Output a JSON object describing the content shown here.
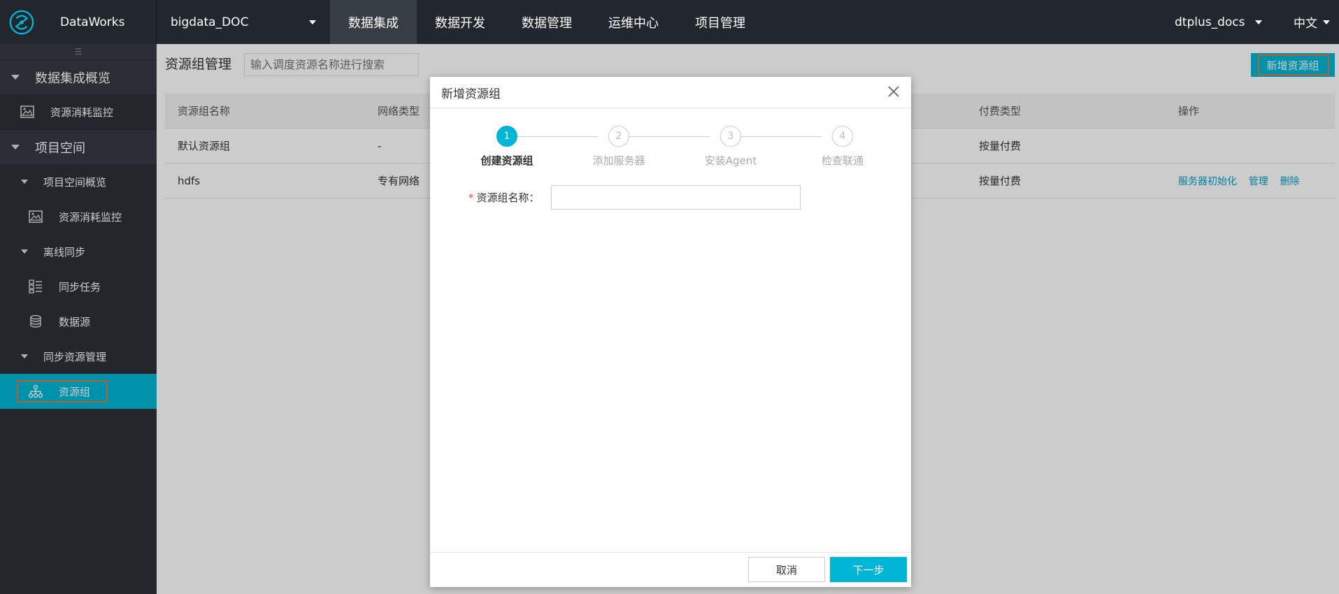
{
  "topbar": {
    "brand": "DataWorks",
    "project": "bigdata_DOC",
    "tabs": [
      {
        "label": "数据集成",
        "active": true
      },
      {
        "label": "数据开发",
        "active": false
      },
      {
        "label": "数据管理",
        "active": false
      },
      {
        "label": "运维中心",
        "active": false
      },
      {
        "label": "项目管理",
        "active": false
      }
    ],
    "user": "dtplus_docs",
    "language": "中文"
  },
  "sidebar": {
    "collapse_icon": "☰",
    "groups": [
      {
        "label": "数据集成概览"
      },
      {
        "label": "项目空间"
      }
    ],
    "items": {
      "overview_monitor": "资源消耗监控",
      "project_overview": "项目空间概览",
      "project_monitor": "资源消耗监控",
      "offline_sync": "离线同步",
      "sync_task": "同步任务",
      "datasource": "数据源",
      "sync_resource_mgmt": "同步资源管理",
      "resource_group": "资源组"
    }
  },
  "main": {
    "title": "资源组管理",
    "search_placeholder": "输入调度资源名称进行搜索",
    "add_button": "新增资源组",
    "table": {
      "headers": [
        "资源组名称",
        "网络类型",
        "付费类型",
        "操作"
      ],
      "rows": [
        {
          "name": "默认资源组",
          "network": "-",
          "billing": "按量付费",
          "ops": []
        },
        {
          "name": "hdfs",
          "network": "专有网络",
          "billing": "按量付费",
          "ops": [
            "服务器初始化",
            "管理",
            "删除"
          ]
        }
      ]
    }
  },
  "modal": {
    "title": "新增资源组",
    "steps": [
      {
        "num": "1",
        "title": "创建资源组",
        "active": true
      },
      {
        "num": "2",
        "title": "添加服务器",
        "active": false
      },
      {
        "num": "3",
        "title": "安装Agent",
        "active": false
      },
      {
        "num": "4",
        "title": "检查联通",
        "active": false
      }
    ],
    "form": {
      "required_mark": "*",
      "name_label": "资源组名称：",
      "name_value": ""
    },
    "cancel": "取消",
    "next": "下一步"
  },
  "colors": {
    "accent": "#00b6d6",
    "topbar": "#22272d",
    "sidebar": "#2c3036",
    "highlight_outline": "#e07a3f"
  }
}
